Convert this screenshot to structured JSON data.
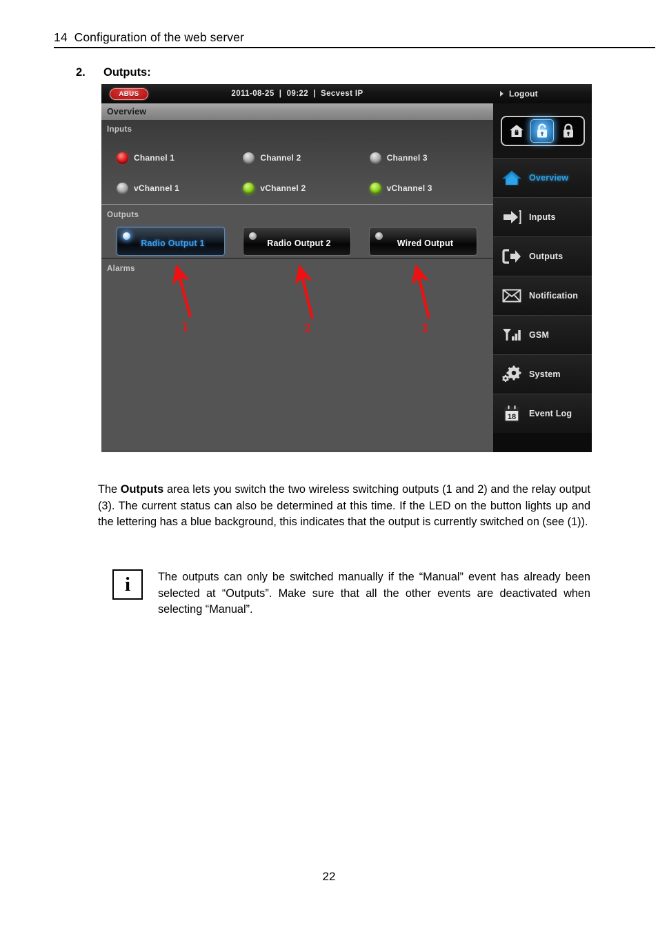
{
  "document": {
    "running_header": "14  Configuration of the web server",
    "page_number": "22",
    "step": {
      "number": "2.",
      "title": "Outputs:"
    },
    "body_paragraph": {
      "lead": "The ",
      "bold": "Outputs",
      "rest": " area lets you switch the two wireless switching outputs (1 and 2) and the relay output (3). The current status can also be determined at this time. If the LED on the button lights up and the lettering has a blue background, this indicates that the output is currently switched on (see (1))."
    },
    "note": {
      "icon": "info-icon",
      "glyph": "i",
      "text": "The outputs can only be switched manually if the “Manual” event has already been selected at “Outputs”. Make sure that all the other events are deactivated when selecting “Manual”."
    }
  },
  "screenshot": {
    "titlebar": {
      "logo": "ABUS",
      "logo_icon": "abus-logo",
      "status_line": "2011-08-25  |  09:22  |  Secvest IP"
    },
    "page_title": "Overview",
    "logout": {
      "label": "Logout",
      "caret_icon": "caret-right-icon"
    },
    "arm_control": {
      "buttons": [
        {
          "name": "internal-arm",
          "icon": "home-lock-icon",
          "selected": false
        },
        {
          "name": "disarm",
          "icon": "unlock-icon",
          "selected": true
        },
        {
          "name": "arm",
          "icon": "lock-icon",
          "selected": false
        }
      ]
    },
    "sections": {
      "inputs": {
        "label": "Inputs",
        "channels": [
          {
            "label": "Channel 1",
            "state": "red"
          },
          {
            "label": "Channel 2",
            "state": "grey"
          },
          {
            "label": "Channel 3",
            "state": "grey"
          },
          {
            "label": "vChannel 1",
            "state": "grey"
          },
          {
            "label": "vChannel 2",
            "state": "green"
          },
          {
            "label": "vChannel 3",
            "state": "green"
          }
        ]
      },
      "outputs": {
        "label": "Outputs",
        "buttons": [
          {
            "label": "Radio Output 1",
            "active": true
          },
          {
            "label": "Radio Output 2",
            "active": false
          },
          {
            "label": "Wired Output",
            "active": false
          }
        ]
      },
      "alarms": {
        "label": "Alarms"
      }
    },
    "nav": [
      {
        "label": "Overview",
        "icon": "home-icon",
        "active": true
      },
      {
        "label": "Inputs",
        "icon": "arrow-in-icon",
        "active": false
      },
      {
        "label": "Outputs",
        "icon": "arrow-out-icon",
        "active": false
      },
      {
        "label": "Notification",
        "icon": "envelope-icon",
        "active": false
      },
      {
        "label": "GSM",
        "icon": "signal-bars-icon",
        "active": false
      },
      {
        "label": "System",
        "icon": "gear-icon",
        "active": false
      },
      {
        "label": "Event Log",
        "icon": "calendar-icon",
        "active": false,
        "icon_text": "18"
      }
    ]
  },
  "annotations": {
    "color": "#ee1111",
    "callouts": [
      {
        "number": "1",
        "target": "Radio Output 1"
      },
      {
        "number": "2",
        "target": "Radio Output 2"
      },
      {
        "number": "3",
        "target": "Wired Output"
      }
    ]
  }
}
